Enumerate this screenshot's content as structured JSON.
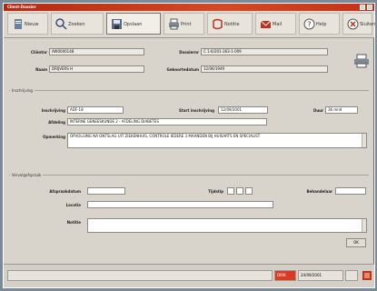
{
  "window": {
    "title": "Client-Dossier"
  },
  "colors": {
    "title_bar": "#c0321a",
    "accent_red": "#d83a24",
    "panel": "#d8d4cc"
  },
  "toolbar": {
    "items": [
      {
        "label": "Nieuw",
        "icon": "document-icon"
      },
      {
        "label": "Zoeken",
        "icon": "search-icon"
      },
      {
        "label": "Opslaan",
        "icon": "save-icon"
      },
      {
        "label": "Print",
        "icon": "printer-icon"
      },
      {
        "label": "Notitie",
        "icon": "note-icon"
      },
      {
        "label": "Mail",
        "icon": "mail-icon"
      },
      {
        "label": "Help",
        "icon": "help-icon"
      },
      {
        "label": "Sluiten",
        "icon": "close-icon"
      }
    ]
  },
  "client": {
    "nummer_label": "Cliëntnr",
    "nummer_value": "AW0000148",
    "naam_label": "Naam",
    "naam_value": "DRIJVERS H",
    "dossier_label": "Dossiernr",
    "dossier_value": "C 1-6/201-363-1-009",
    "geboorte_label": "Geboortedatum",
    "geboorte_value": "12/06/1949"
  },
  "section1": {
    "title": "Inschrijving",
    "code_label": "Inschrijving",
    "code_value": "ADF-18",
    "start_label": "Start inschrijving",
    "start_value": "12/09/2001",
    "duur_label": "Duur",
    "duur_value": "36 mnd",
    "adres_label": "Afdeling",
    "adres_value": "INTERNE GENEESKUNDE 2 - AFDELING DIABETES",
    "opm_label": "Opmerking",
    "opm_value": "OPVOLGING NA ONTSLAG UIT ZIEKENHUIS, CONTROLE IEDERE 3 MAANDEN BIJ HUISARTS EN SPECIALIST"
  },
  "section2": {
    "title": "Vervolgafspraak",
    "datum_label": "Afspraakdatum",
    "datum_value": "",
    "tijd_label": "Tijdstip",
    "tijd_value": "",
    "arts_label": "Behandelaar",
    "arts_value": "",
    "locatie_label": "Locatie",
    "locatie_value": "",
    "notitie_label": "Notitie",
    "notitie_value": ""
  },
  "buttons": {
    "ok": "OK"
  },
  "status": {
    "field1": "",
    "field2": "",
    "user": "DIRK",
    "date": "24/09/2001"
  }
}
